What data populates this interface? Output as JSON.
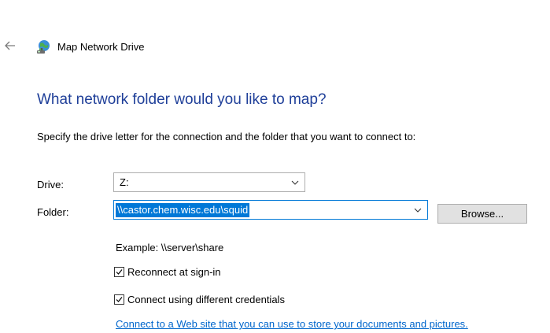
{
  "window": {
    "title": "Map Network Drive",
    "back_icon": "back-arrow-icon",
    "title_icon": "network-drive-icon"
  },
  "main": {
    "heading": "What network folder would you like to map?",
    "instruction": "Specify the drive letter for the connection and the folder that you want to connect to:"
  },
  "drive": {
    "label": "Drive:",
    "value": "Z:"
  },
  "folder": {
    "label": "Folder:",
    "value": "\\\\castor.chem.wisc.edu\\squid",
    "selected": true,
    "browse_label": "Browse...",
    "example": "Example: \\\\server\\share"
  },
  "options": {
    "reconnect": {
      "label": "Reconnect at sign-in",
      "checked": true
    },
    "credentials": {
      "label": "Connect using different credentials",
      "checked": true
    }
  },
  "link": {
    "text": "Connect to a Web site that you can use to store your documents and pictures."
  },
  "colors": {
    "heading": "#1f3f99",
    "accent": "#0078d7",
    "link": "#0066cc"
  }
}
